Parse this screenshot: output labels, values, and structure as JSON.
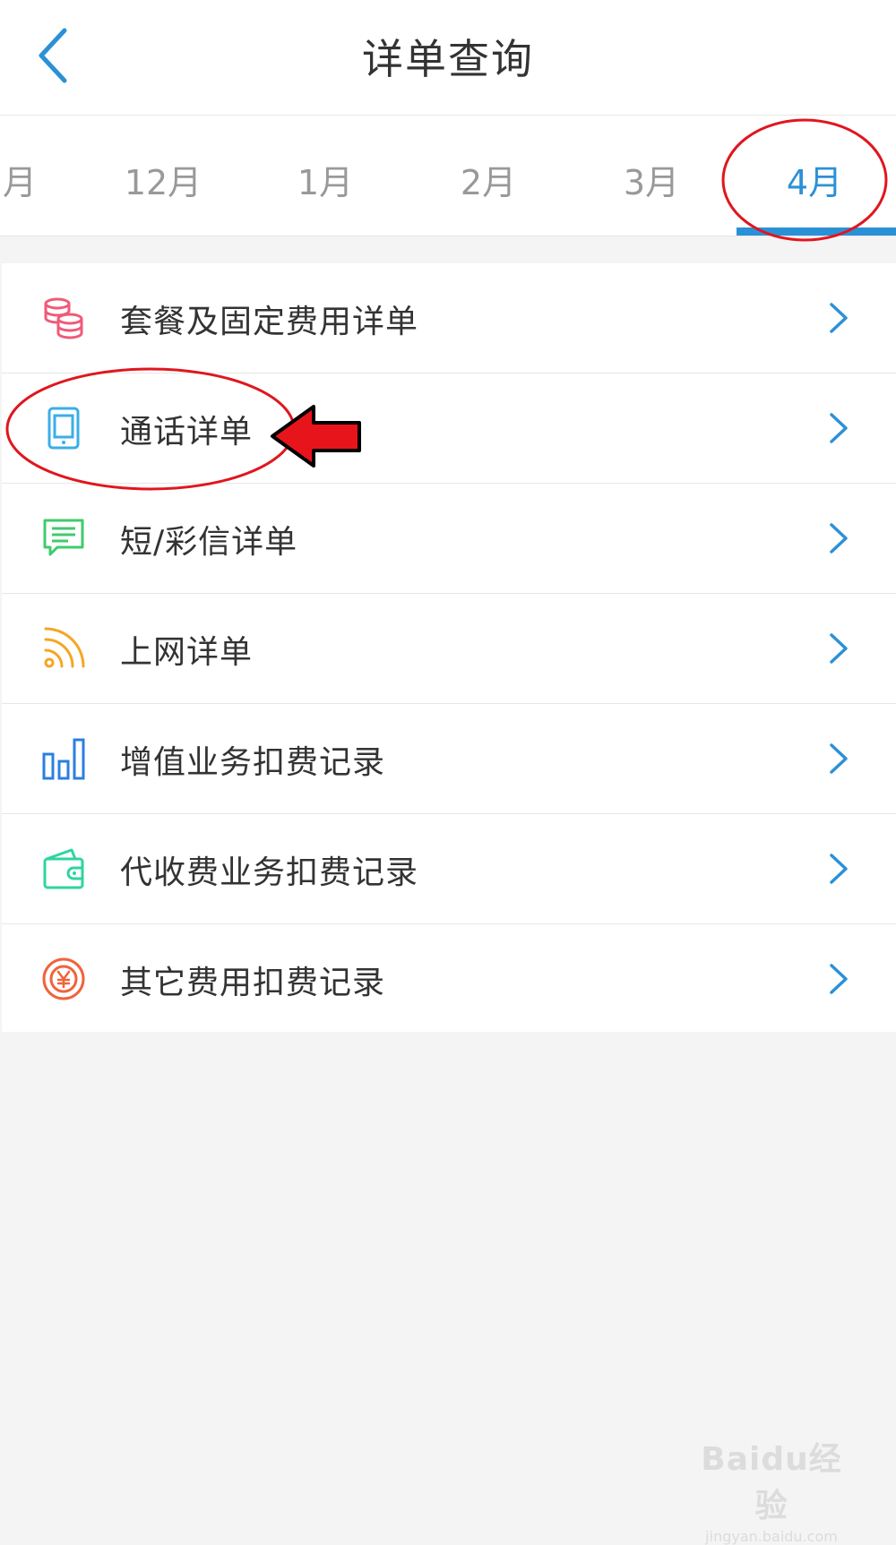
{
  "header": {
    "title": "详单查询",
    "back_icon": "chevron-left-icon"
  },
  "months": {
    "tabs": [
      "月",
      "12月",
      "1月",
      "2月",
      "3月",
      "4月"
    ],
    "selected": "4月",
    "active_color": "#2b91d6"
  },
  "list": {
    "items": [
      {
        "label": "套餐及固定费用详单",
        "icon": "coin-stack-icon",
        "color": "#f05a78"
      },
      {
        "label": "通话详单",
        "icon": "tablet-icon",
        "color": "#3aaee8"
      },
      {
        "label": "短/彩信详单",
        "icon": "message-icon",
        "color": "#3fcb6e"
      },
      {
        "label": "上网详单",
        "icon": "rss-icon",
        "color": "#f5a623"
      },
      {
        "label": "增值业务扣费记录",
        "icon": "bar-chart-icon",
        "color": "#2b7fe0"
      },
      {
        "label": "代收费业务扣费记录",
        "icon": "wallet-icon",
        "color": "#2fd4a0"
      },
      {
        "label": "其它费用扣费记录",
        "icon": "yuan-coin-icon",
        "color": "#f0633c"
      }
    ]
  },
  "watermark": {
    "brand": "Baidu经验",
    "url": "jingyan.baidu.com"
  }
}
